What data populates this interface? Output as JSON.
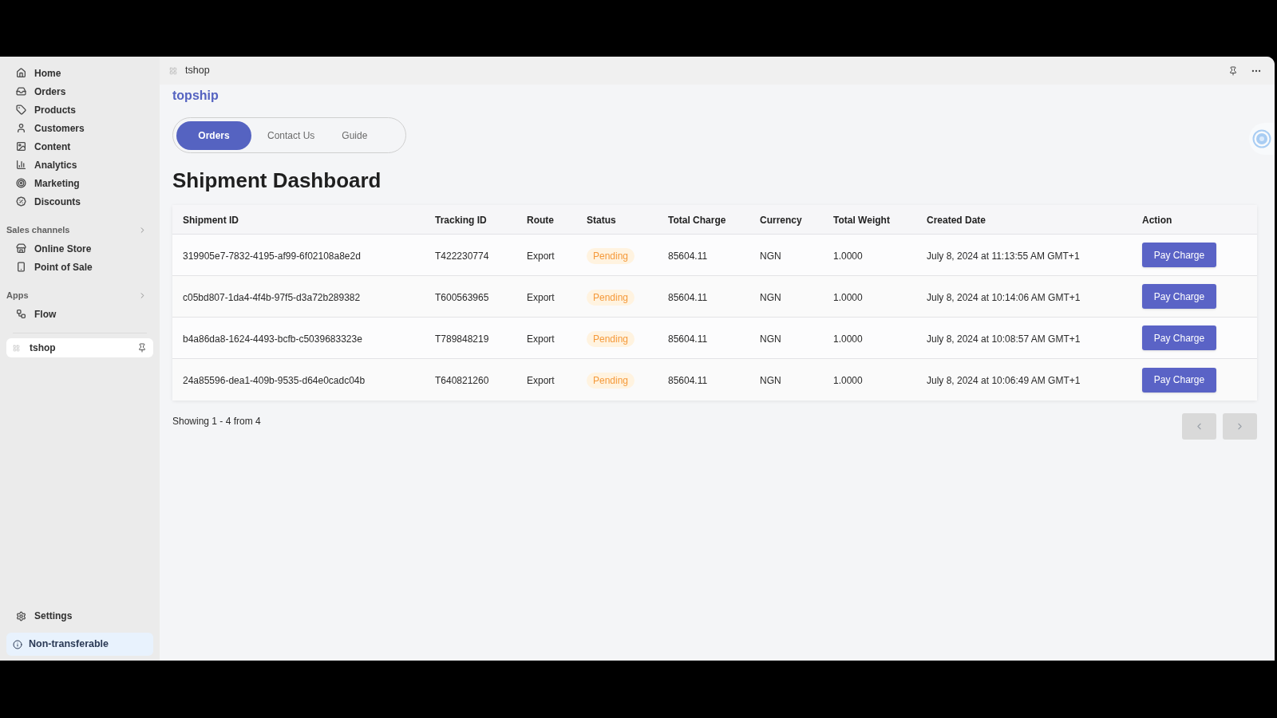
{
  "sidebar": {
    "nav": [
      {
        "label": "Home",
        "kind": "home",
        "selected": false
      },
      {
        "label": "Orders",
        "kind": "orders",
        "selected": false
      },
      {
        "label": "Products",
        "kind": "products",
        "selected": false
      },
      {
        "label": "Customers",
        "kind": "customers",
        "selected": false
      },
      {
        "label": "Content",
        "kind": "content",
        "selected": false
      },
      {
        "label": "Analytics",
        "kind": "analytics",
        "selected": false
      },
      {
        "label": "Marketing",
        "kind": "marketing",
        "selected": false
      },
      {
        "label": "Discounts",
        "kind": "discounts",
        "selected": false
      }
    ],
    "sections": [
      {
        "title": "Sales channels",
        "items": [
          {
            "label": "Online Store",
            "kind": "store",
            "selected": false
          },
          {
            "label": "Point of Sale",
            "kind": "pos",
            "selected": false
          }
        ]
      },
      {
        "title": "Apps",
        "items": [
          {
            "label": "Flow",
            "kind": "flow",
            "selected": false
          }
        ]
      }
    ],
    "pinned_app": {
      "label": "tshop",
      "selected": true
    },
    "settings": "Settings",
    "notice": "Non-transferable"
  },
  "header": {
    "title": "tshop"
  },
  "brand": "topship",
  "tabs": [
    {
      "label": "Orders",
      "selected": true
    },
    {
      "label": "Contact Us",
      "selected": false
    },
    {
      "label": "Guide",
      "selected": false
    }
  ],
  "page_title": "Shipment Dashboard",
  "table": {
    "columns": [
      "Shipment ID",
      "Tracking ID",
      "Route",
      "Status",
      "Total Charge",
      "Currency",
      "Total Weight",
      "Created Date",
      "Action"
    ],
    "rows": [
      {
        "shipment_id": "319905e7-7832-4195-af99-6f02108a8e2d",
        "tracking_id": "T422230774",
        "route": "Export",
        "status": "Pending",
        "total_charge": "85604.11",
        "currency": "NGN",
        "total_weight": "1.0000",
        "created_date": "July 8, 2024 at 11:13:55 AM GMT+1",
        "action": "Pay Charge"
      },
      {
        "shipment_id": "c05bd807-1da4-4f4b-97f5-d3a72b289382",
        "tracking_id": "T600563965",
        "route": "Export",
        "status": "Pending",
        "total_charge": "85604.11",
        "currency": "NGN",
        "total_weight": "1.0000",
        "created_date": "July 8, 2024 at 10:14:06 AM GMT+1",
        "action": "Pay Charge"
      },
      {
        "shipment_id": "b4a86da8-1624-4493-bcfb-c5039683323e",
        "tracking_id": "T789848219",
        "route": "Export",
        "status": "Pending",
        "total_charge": "85604.11",
        "currency": "NGN",
        "total_weight": "1.0000",
        "created_date": "July 8, 2024 at 10:08:57 AM GMT+1",
        "action": "Pay Charge"
      },
      {
        "shipment_id": "24a85596-dea1-409b-9535-d64e0cadc04b",
        "tracking_id": "T640821260",
        "route": "Export",
        "status": "Pending",
        "total_charge": "85604.11",
        "currency": "NGN",
        "total_weight": "1.0000",
        "created_date": "July 8, 2024 at 10:06:49 AM GMT+1",
        "action": "Pay Charge"
      }
    ]
  },
  "pagination": {
    "summary": "Showing 1 - 4 from 4"
  }
}
